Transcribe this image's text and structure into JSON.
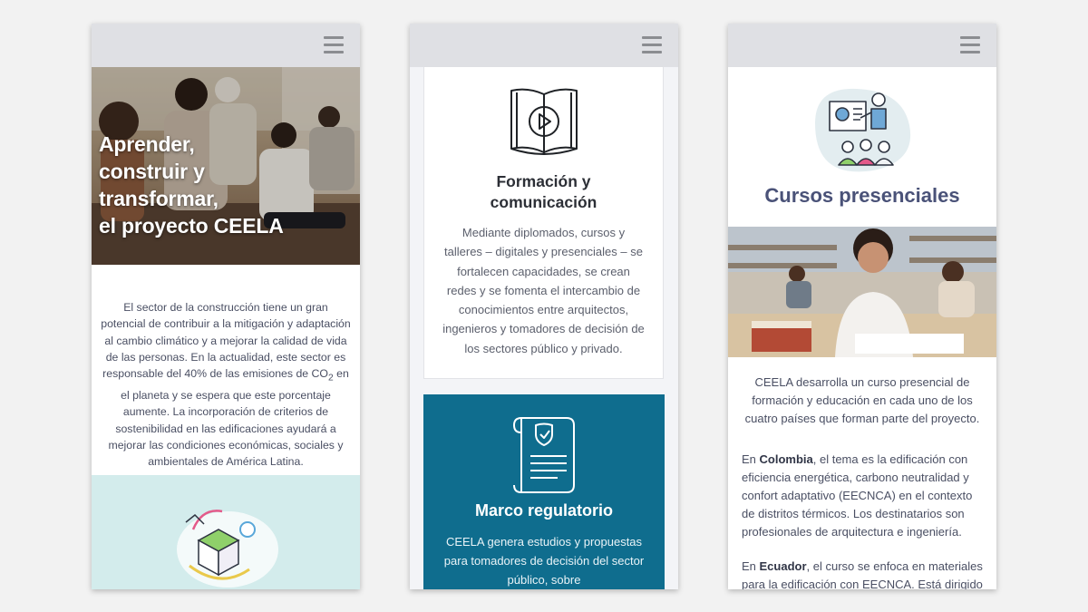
{
  "phone1": {
    "hero_title_lines": [
      "Aprender,",
      "construir y",
      "transformar,",
      "el proyecto CEELA"
    ],
    "intro_before_sub": "El sector de la construcción tiene un gran potencial de contribuir a la mitigación y adaptación al cambio climático y a mejorar la calidad de vida de las personas. En la actualidad, este sector es responsable del 40% de las emisiones de CO",
    "intro_sub": "2",
    "intro_after_sub": " en el planeta y se espera que este porcentaje aumente. La incorporación de criterios de sostenibilidad en las edificaciones ayudará a mejorar las condiciones económicas, sociales y ambientales de América Latina."
  },
  "phone2": {
    "card1": {
      "title_lines": [
        "Formación y",
        "comunicación"
      ],
      "text": "Mediante diplomados, cursos y talleres – digitales y presenciales – se fortalecen capacidades, se crean redes y se fomenta el intercambio de conocimientos entre arquitectos, ingenieros y tomadores de decisión de los sectores público y privado."
    },
    "card2": {
      "title": "Marco regulatorio",
      "text": "CEELA genera estudios y propuestas para tomadores de decisión del sector público, sobre"
    }
  },
  "phone3": {
    "title": "Cursos presenciales",
    "lead": "CEELA desarrolla un curso presencial de formación y educación en cada uno de los cuatro países que forman parte del proyecto.",
    "colombia": {
      "prefix": "En ",
      "country": "Colombia",
      "text": ", el tema es la edificación con eficiencia energética, carbono neutralidad y confort adaptativo (EECNCA) en el contexto de distritos térmicos. Los destinatarios son profesionales de arquitectura e ingeniería."
    },
    "ecuador": {
      "prefix": "En ",
      "country": "Ecuador",
      "text": ", el curso se enfoca en materiales para la edificación con EECNCA. Está dirigido a"
    }
  },
  "colors": {
    "background": "#f2f2f2",
    "topbar": "#dfe0e4",
    "teal_card": "#0f6d8e",
    "teal_light": "#d3ecec",
    "title_blue": "#4a5278"
  },
  "icons": [
    "menu-icon",
    "book-play-icon",
    "document-shield-icon",
    "teacher-presentation-icon",
    "building-blocks-icon"
  ]
}
